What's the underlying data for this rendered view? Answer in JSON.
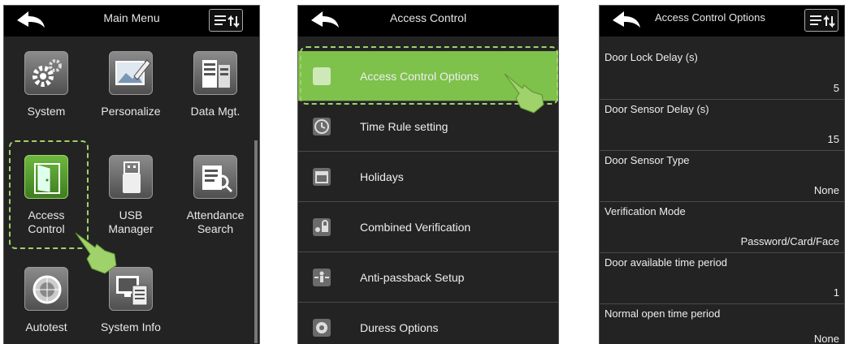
{
  "main_menu": {
    "title": "Main Menu",
    "items": [
      {
        "label_line1": "System",
        "label_line2": ""
      },
      {
        "label_line1": "Personalize",
        "label_line2": ""
      },
      {
        "label_line1": "Data Mgt.",
        "label_line2": ""
      },
      {
        "label_line1": "Access",
        "label_line2": "Control"
      },
      {
        "label_line1": "USB",
        "label_line2": "Manager"
      },
      {
        "label_line1": "Attendance",
        "label_line2": "Search"
      },
      {
        "label_line1": "Autotest",
        "label_line2": ""
      },
      {
        "label_line1": "System Info",
        "label_line2": ""
      }
    ]
  },
  "access_control": {
    "title": "Access Control",
    "items": [
      {
        "label": "Access Control Options"
      },
      {
        "label": "Time Rule setting"
      },
      {
        "label": "Holidays"
      },
      {
        "label": "Combined Verification"
      },
      {
        "label": "Anti-passback Setup"
      },
      {
        "label": "Duress Options"
      }
    ]
  },
  "access_options": {
    "title": "Access Control Options",
    "items": [
      {
        "label": "Door Lock Delay (s)",
        "value": "5"
      },
      {
        "label": "Door Sensor Delay (s)",
        "value": "15"
      },
      {
        "label": "Door Sensor Type",
        "value": "None"
      },
      {
        "label": "Verification Mode",
        "value": "Password/Card/Face"
      },
      {
        "label": "Door available time period",
        "value": "1"
      },
      {
        "label": "Normal open time period",
        "value": "None"
      }
    ]
  },
  "colors": {
    "highlight": "#7ec14b",
    "dash": "#9fd26a",
    "background": "#232323",
    "titlebar": "#000000"
  }
}
